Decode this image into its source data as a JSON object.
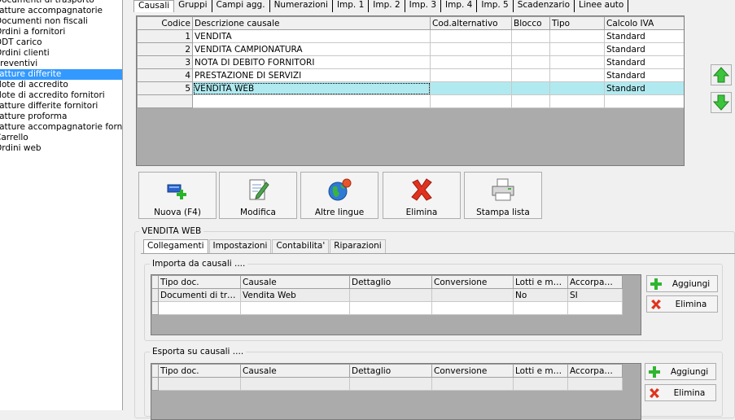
{
  "nav": {
    "items": [
      {
        "label": "Documenti di trasporto",
        "selected": false
      },
      {
        "label": "Fatture accompagnatorie",
        "selected": false
      },
      {
        "label": "Documenti non fiscali",
        "selected": false
      },
      {
        "label": "Ordini a fornitori",
        "selected": false
      },
      {
        "label": "DDT carico",
        "selected": false
      },
      {
        "label": "Ordini clienti",
        "selected": false
      },
      {
        "label": "Preventivi",
        "selected": false
      },
      {
        "label": "Fatture differite",
        "selected": true
      },
      {
        "label": "Note di accredito",
        "selected": false
      },
      {
        "label": "Note di accredito fornitori",
        "selected": false
      },
      {
        "label": "Fatture differite fornitori",
        "selected": false
      },
      {
        "label": "Fatture proforma",
        "selected": false
      },
      {
        "label": "Fatture accompagnatorie fornitori",
        "selected": false
      },
      {
        "label": "Carrello",
        "selected": false
      },
      {
        "label": "Ordini web",
        "selected": false
      }
    ]
  },
  "top_tabs": [
    "Causali",
    "Gruppi",
    "Campi agg.",
    "Numerazioni",
    "Imp. 1",
    "Imp. 2",
    "Imp. 3",
    "Imp. 4",
    "Imp. 5",
    "Scadenzario",
    "Linee auto"
  ],
  "causali_grid": {
    "columns": [
      "Codice",
      "Descrizione causale",
      "Cod.alternativo",
      "Blocco",
      "Tipo",
      "Calcolo IVA"
    ],
    "rows": [
      {
        "codice": "1",
        "descrizione": "VENDITA",
        "cod_alt": "",
        "blocco": "",
        "tipo": "",
        "iva": "Standard"
      },
      {
        "codice": "2",
        "descrizione": "VENDITA CAMPIONATURA",
        "cod_alt": "",
        "blocco": "",
        "tipo": "",
        "iva": "Standard"
      },
      {
        "codice": "3",
        "descrizione": "NOTA DI DEBITO FORNITORI",
        "cod_alt": "",
        "blocco": "",
        "tipo": "",
        "iva": "Standard"
      },
      {
        "codice": "4",
        "descrizione": "PRESTAZIONE DI SERVIZI",
        "cod_alt": "",
        "blocco": "",
        "tipo": "",
        "iva": "Standard"
      },
      {
        "codice": "5",
        "descrizione": "VENDITA WEB",
        "cod_alt": "",
        "blocco": "",
        "tipo": "",
        "iva": "Standard"
      }
    ]
  },
  "toolbar": {
    "nuova": "Nuova (F4)",
    "modifica": "Modifica",
    "altre_lingue": "Altre lingue",
    "elimina": "Elimina",
    "stampa": "Stampa lista"
  },
  "detail": {
    "title": "VENDITA WEB",
    "tabs": [
      "Collegamenti",
      "Impostazioni",
      "Contabilita'",
      "Riparazioni"
    ],
    "importa": {
      "legend": "Importa da causali ....",
      "columns": [
        "Tipo doc.",
        "Causale",
        "Dettaglio",
        "Conversione",
        "Lotti e ma...",
        "Accorpam..."
      ],
      "rows": [
        {
          "tipo": "Documenti di tra...",
          "causale": "Vendita Web",
          "dettaglio": "",
          "conversione": "",
          "lotti": "No",
          "accorp": "SI"
        }
      ],
      "add": "Aggiungi",
      "delete": "Elimina"
    },
    "esporta": {
      "legend": "Esporta su causali ....",
      "columns": [
        "Tipo doc.",
        "Causale",
        "Dettaglio",
        "Conversione",
        "Lotti e ma...",
        "Accorpam..."
      ],
      "add": "Aggiungi",
      "delete": "Elimina"
    }
  }
}
